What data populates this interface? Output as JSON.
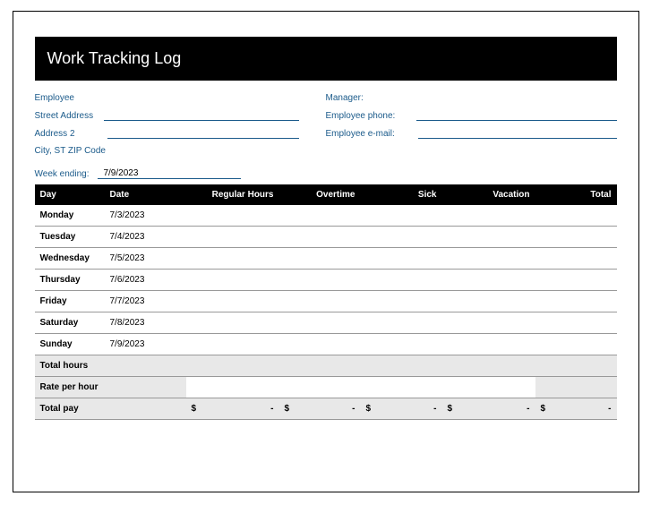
{
  "title": "Work Tracking Log",
  "info": {
    "employee_label": "Employee",
    "street_label": "Street Address",
    "address2_label": "Address 2",
    "citystzip_label": "City, ST  ZIP Code",
    "manager_label": "Manager:",
    "phone_label": "Employee phone:",
    "email_label": "Employee e-mail:"
  },
  "week_ending_label": "Week ending:",
  "week_ending_value": "7/9/2023",
  "headers": {
    "day": "Day",
    "date": "Date",
    "regular": "Regular Hours",
    "overtime": "Overtime",
    "sick": "Sick",
    "vacation": "Vacation",
    "total": "Total"
  },
  "rows": [
    {
      "day": "Monday",
      "date": "7/3/2023"
    },
    {
      "day": "Tuesday",
      "date": "7/4/2023"
    },
    {
      "day": "Wednesday",
      "date": "7/5/2023"
    },
    {
      "day": "Thursday",
      "date": "7/6/2023"
    },
    {
      "day": "Friday",
      "date": "7/7/2023"
    },
    {
      "day": "Saturday",
      "date": "7/8/2023"
    },
    {
      "day": "Sunday",
      "date": "7/9/2023"
    }
  ],
  "totals": {
    "total_hours_label": "Total hours",
    "rate_label": "Rate per hour",
    "total_pay_label": "Total pay",
    "currency": "$",
    "dash": "-"
  }
}
